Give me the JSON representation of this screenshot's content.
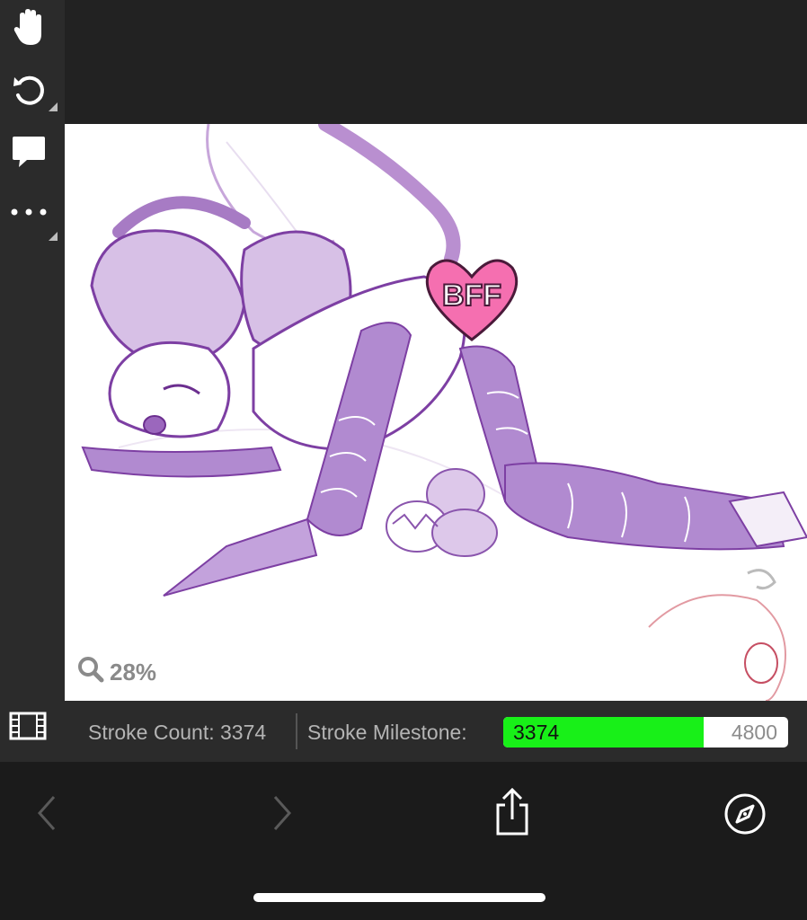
{
  "toolbar": {
    "tools": [
      {
        "name": "hand-icon"
      },
      {
        "name": "undo-icon"
      },
      {
        "name": "comment-icon"
      },
      {
        "name": "more-icon"
      }
    ]
  },
  "canvas": {
    "zoom_label": "28%",
    "badge_text": "BFF"
  },
  "status": {
    "stroke_count_label": "Stroke Count: 3374",
    "milestone_label": "Stroke Milestone:",
    "milestone_current": "3374",
    "milestone_target": "4800",
    "milestone_progress": 0.703,
    "progress_color": "#18f018"
  },
  "browser": {
    "buttons": [
      {
        "name": "back-icon"
      },
      {
        "name": "forward-icon"
      },
      {
        "name": "share-icon"
      },
      {
        "name": "compass-icon"
      }
    ]
  }
}
